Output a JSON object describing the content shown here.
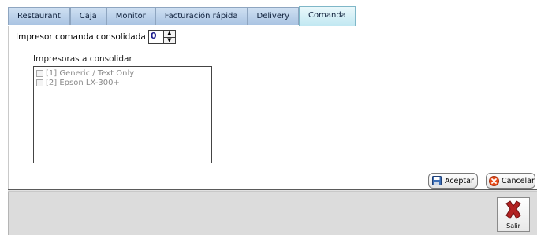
{
  "tabs": [
    {
      "label": "Restaurant",
      "active": false
    },
    {
      "label": "Caja",
      "active": false
    },
    {
      "label": "Monitor",
      "active": false
    },
    {
      "label": "Facturación rápida",
      "active": false
    },
    {
      "label": "Delivery",
      "active": false
    },
    {
      "label": "Comanda",
      "active": true
    }
  ],
  "consolidated_printer": {
    "label": "Impresor comanda consolidada",
    "value": "0"
  },
  "printers_group": {
    "label": "Impresoras a consolidar",
    "items": [
      {
        "label": "[1] Generic / Text Only",
        "checked": false
      },
      {
        "label": "[2] Epson LX-300+",
        "checked": false
      }
    ]
  },
  "buttons": {
    "accept": "Aceptar",
    "cancel": "Cancelar",
    "exit": "Salir"
  },
  "colors": {
    "tab_active": "#bfe7f1",
    "tab_inactive": "#a9c3e2",
    "cancel_icon": "#e64a19",
    "exit_icon": "#b22222"
  },
  "icons": {
    "accept": "floppy-disk-icon",
    "cancel": "cancel-circle-icon",
    "exit": "red-x-icon"
  }
}
